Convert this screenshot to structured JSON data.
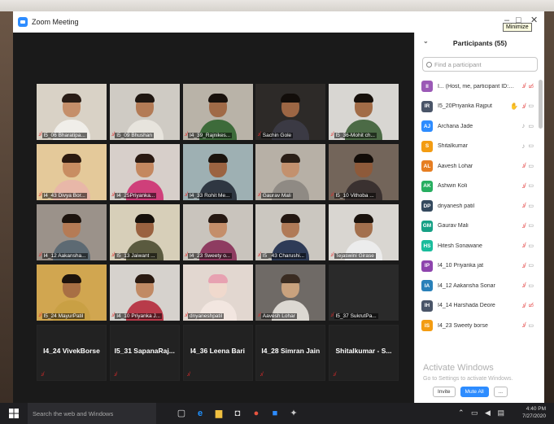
{
  "window": {
    "title": "Zoom Meeting",
    "tooltip": "Minimize",
    "min": "–",
    "max": "□",
    "close": "✕"
  },
  "tiles": [
    {
      "name": "I5_06 Bharatipa...",
      "bg": "#d9d2c6",
      "skin": "#c58f6a",
      "hair": "#2a1d16",
      "shirt": "#f0eee9",
      "type": "video"
    },
    {
      "name": "I5_09 Bhushan",
      "bg": "#cfcbc4",
      "skin": "#b37b56",
      "hair": "#1f1712",
      "shirt": "#e7e4dd",
      "type": "video"
    },
    {
      "name": "I4_39_Rajnikes...",
      "bg": "#b9b3a8",
      "skin": "#a06a47",
      "hair": "#18110c",
      "shirt": "#3d6b3a",
      "type": "video"
    },
    {
      "name": "Sachin Gole",
      "bg": "#2d2a28",
      "skin": "#9c6644",
      "hair": "#120d0a",
      "shirt": "#3b3a44",
      "type": "video"
    },
    {
      "name": "I5_36-Mohit ch...",
      "bg": "#d8d6d2",
      "skin": "#a26c47",
      "hair": "#17100b",
      "shirt": "#4c6b46",
      "type": "video"
    },
    {
      "name": "I4_43 Divya Bor...",
      "bg": "#e4c99a",
      "skin": "#c88d62",
      "hair": "#2c1a10",
      "shirt": "#e8b7a8",
      "type": "video"
    },
    {
      "name": "I4_25Priyanka...",
      "bg": "#d7cfca",
      "skin": "#c48860",
      "hair": "#2a1a12",
      "shirt": "#cf3f7a",
      "type": "video"
    },
    {
      "name": "I4_33 Rohit Me...",
      "bg": "#9eb0b3",
      "skin": "#9b6341",
      "hair": "#1b130e",
      "shirt": "#2f3742",
      "type": "video"
    },
    {
      "name": "Gaurav Mali",
      "bg": "#b7b0a6",
      "skin": "#c3916e",
      "hair": "#2b1f17",
      "shirt": "#8f8a84",
      "type": "video"
    },
    {
      "name": "I5_10 Vithoba ...",
      "bg": "#73655a",
      "skin": "#8e5a3a",
      "hair": "#120c08",
      "shirt": "#3a3130",
      "type": "video"
    },
    {
      "name": "I4_12 Aakansha...",
      "bg": "#9b928a",
      "skin": "#b57b55",
      "hair": "#1d140e",
      "shirt": "#5d6a73",
      "type": "video"
    },
    {
      "name": "I5_13 Jaiwant ...",
      "bg": "#d7cfb9",
      "skin": "#9a6240",
      "hair": "#16100b",
      "shirt": "#5a5a3f",
      "type": "video"
    },
    {
      "name": "I4_23 Sweety o...",
      "bg": "#c9c4bd",
      "skin": "#c48e6a",
      "hair": "#251812",
      "shirt": "#8e3c61",
      "type": "video"
    },
    {
      "name": "I5 _43 Charushi...",
      "bg": "#cbc7c0",
      "skin": "#b07a57",
      "hair": "#231711",
      "shirt": "#2e3b57",
      "type": "video"
    },
    {
      "name": "Tejaswini Girase",
      "bg": "#d9d6d1",
      "skin": "#a3704d",
      "hair": "#1a120c",
      "shirt": "#ececec",
      "type": "video"
    },
    {
      "name": "I5_24 MayurPatil",
      "bg": "#d1a650",
      "skin": "#a86f44",
      "hair": "#1d130c",
      "shirt": "#c9a044",
      "type": "video"
    },
    {
      "name": "I4_10 Priyanka J...",
      "bg": "#d6d2cd",
      "skin": "#c18a64",
      "hair": "#2a1a11",
      "shirt": "#b83b4a",
      "type": "video"
    },
    {
      "name": "dnyaneshpatil",
      "bg": "#e2d7d0",
      "skin": "#f0d9cd",
      "hair": "#e7a1b1",
      "shirt": "#f2e6e0",
      "type": "video"
    },
    {
      "name": "Aavesh Lohar",
      "bg": "#6f6a66",
      "skin": "#c9a27e",
      "hair": "#3a2c22",
      "shirt": "#dcd8d2",
      "type": "video"
    },
    {
      "name": "I5_37 SukrutPa...",
      "bg": "#2a2a2a",
      "skin": "#2a2a2a",
      "hair": "#2a2a2a",
      "shirt": "#2a2a2a",
      "type": "blank"
    },
    {
      "name": "I4_24 VivekBorse",
      "type": "name"
    },
    {
      "name": "I5_31 SapanaRaj...",
      "type": "name"
    },
    {
      "name": "I4_36 Leena Bari",
      "type": "name"
    },
    {
      "name": "I4_28 Simran Jain",
      "type": "name"
    },
    {
      "name": "Shitalkumar - S...",
      "type": "name"
    }
  ],
  "panel": {
    "title": "Participants (55)",
    "search_placeholder": "Find a participant",
    "participants": [
      {
        "initials": "II",
        "name": "I... (Host, me, participant ID: 230983)",
        "color": "#9b59b6",
        "audio": "off",
        "video": "off-red",
        "hand": false
      },
      {
        "initials": "IR",
        "name": "I5_20Priyanka Rajput",
        "color": "#4a5568",
        "audio": "off",
        "video": "off",
        "hand": true
      },
      {
        "initials": "AJ",
        "name": "Archana Jade",
        "color": "#2d8cff",
        "audio": "on",
        "video": "off",
        "hand": false
      },
      {
        "initials": "S",
        "name": "Shitalkumar",
        "color": "#f39c12",
        "audio": "on",
        "video": "off",
        "hand": false
      },
      {
        "initials": "AL",
        "name": "Aavesh Lohar",
        "color": "#e67e22",
        "audio": "off",
        "video": "off",
        "hand": false
      },
      {
        "initials": "AK",
        "name": "Ashwin Koli",
        "color": "#27ae60",
        "audio": "off",
        "video": "off",
        "hand": false
      },
      {
        "initials": "DP",
        "name": "dnyanesh patil",
        "color": "#34495e",
        "audio": "off",
        "video": "off",
        "hand": false
      },
      {
        "initials": "GM",
        "name": "Gaurav Mali",
        "color": "#16a085",
        "audio": "off",
        "video": "off",
        "hand": false
      },
      {
        "initials": "HS",
        "name": "Hitesh Sonawane",
        "color": "#1abc9c",
        "audio": "off",
        "video": "off",
        "hand": false
      },
      {
        "initials": "IP",
        "name": "I4_10 Priyanka jat",
        "color": "#8e44ad",
        "audio": "off",
        "video": "off",
        "hand": false
      },
      {
        "initials": "IA",
        "name": "I4_12 Aakansha Sonar",
        "color": "#2980b9",
        "audio": "off",
        "video": "off",
        "hand": false
      },
      {
        "initials": "IH",
        "name": "I4_14 Harshada Deore",
        "color": "#4a5568",
        "audio": "off",
        "video": "off-red",
        "hand": false
      },
      {
        "initials": "IS",
        "name": "I4_23 Sweety borse",
        "color": "#f39c12",
        "audio": "off",
        "video": "off",
        "hand": false
      }
    ],
    "invite": "Invite",
    "mute_all": "Mute All",
    "more": "..."
  },
  "watermark": {
    "line1": "Activate Windows",
    "line2": "Go to Settings to activate Windows."
  },
  "taskbar": {
    "search": "Search the web and Windows",
    "time": "4:40 PM",
    "date": "7/27/2020"
  },
  "colors": {
    "accent": "#2d8cff",
    "muted": "#e02b2b"
  }
}
